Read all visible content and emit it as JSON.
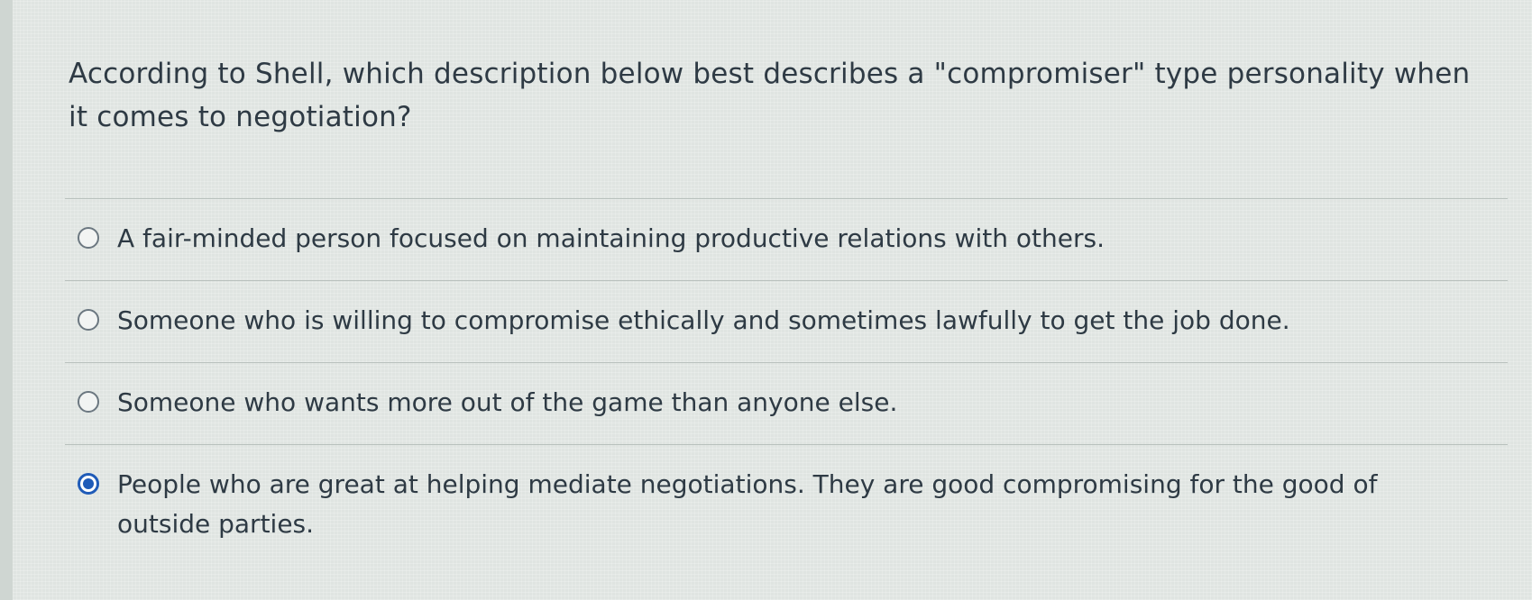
{
  "question": {
    "text": "According to Shell, which description below best describes a \"compromiser\" type personality when it comes to negotiation?"
  },
  "answers": [
    {
      "label": "A fair-minded person focused on maintaining productive relations with others.",
      "selected": false
    },
    {
      "label": "Someone who is willing to compromise ethically and sometimes lawfully to get the job done.",
      "selected": false
    },
    {
      "label": "Someone who wants more out of the game than anyone else.",
      "selected": false
    },
    {
      "label": "People who are great at helping mediate negotiations. They are good compromising for the good of outside parties.",
      "selected": true
    }
  ],
  "colors": {
    "text": "#2e3a44",
    "selected_radio": "#1f5bb8",
    "divider": "#b9c1bd"
  }
}
